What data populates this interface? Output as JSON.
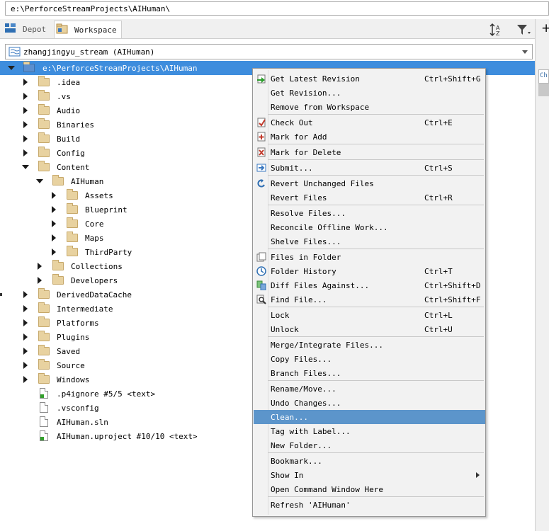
{
  "path_bar": {
    "value": "e:\\PerforceStreamProjects\\AIHuman\\"
  },
  "tabs": [
    {
      "label": "Depot",
      "icon": "depot-icon"
    },
    {
      "label": "Workspace",
      "icon": "workspace-icon"
    }
  ],
  "toolbar": {
    "sort_icon": "sort-az-icon",
    "filter_icon": "filter-icon"
  },
  "right_panel": {
    "plus_label": "+",
    "header_fragment": "Ch"
  },
  "workspace": {
    "name": "zhangjingyu_stream (AIHuman)"
  },
  "tree": {
    "root": "e:\\PerforceStreamProjects\\AIHuman",
    "items": [
      {
        "label": ".idea",
        "type": "folder",
        "depth": 1,
        "state": "collapsed"
      },
      {
        "label": ".vs",
        "type": "folder",
        "depth": 1,
        "state": "collapsed"
      },
      {
        "label": "Audio",
        "type": "folder",
        "depth": 1,
        "state": "collapsed"
      },
      {
        "label": "Binaries",
        "type": "folder",
        "depth": 1,
        "state": "collapsed"
      },
      {
        "label": "Build",
        "type": "folder",
        "depth": 1,
        "state": "collapsed"
      },
      {
        "label": "Config",
        "type": "folder",
        "depth": 1,
        "state": "collapsed"
      },
      {
        "label": "Content",
        "type": "folder",
        "depth": 1,
        "state": "expanded"
      },
      {
        "label": "AIHuman",
        "type": "folder",
        "depth": 2,
        "state": "expanded"
      },
      {
        "label": "Assets",
        "type": "folder",
        "depth": 3,
        "state": "collapsed"
      },
      {
        "label": "Blueprint",
        "type": "folder",
        "depth": 3,
        "state": "collapsed"
      },
      {
        "label": "Core",
        "type": "folder",
        "depth": 3,
        "state": "collapsed"
      },
      {
        "label": "Maps",
        "type": "folder",
        "depth": 3,
        "state": "collapsed"
      },
      {
        "label": "ThirdParty",
        "type": "folder",
        "depth": 3,
        "state": "collapsed"
      },
      {
        "label": "Collections",
        "type": "folder",
        "depth": 2,
        "state": "collapsed"
      },
      {
        "label": "Developers",
        "type": "folder",
        "depth": 2,
        "state": "collapsed"
      },
      {
        "label": "DerivedDataCache",
        "type": "folder",
        "depth": 1,
        "state": "collapsed"
      },
      {
        "label": "Intermediate",
        "type": "folder",
        "depth": 1,
        "state": "collapsed"
      },
      {
        "label": "Platforms",
        "type": "folder",
        "depth": 1,
        "state": "collapsed"
      },
      {
        "label": "Plugins",
        "type": "folder",
        "depth": 1,
        "state": "collapsed"
      },
      {
        "label": "Saved",
        "type": "folder",
        "depth": 1,
        "state": "collapsed"
      },
      {
        "label": "Source",
        "type": "folder",
        "depth": 1,
        "state": "collapsed"
      },
      {
        "label": "Windows",
        "type": "folder",
        "depth": 1,
        "state": "collapsed"
      },
      {
        "label": ".p4ignore #5/5 <text>",
        "type": "file",
        "depth": 1,
        "versioned": true
      },
      {
        "label": ".vsconfig",
        "type": "file",
        "depth": 1,
        "versioned": false
      },
      {
        "label": "AIHuman.sln",
        "type": "file",
        "depth": 1,
        "versioned": false
      },
      {
        "label": "AIHuman.uproject #10/10 <text>",
        "type": "file",
        "depth": 1,
        "versioned": true
      }
    ]
  },
  "context_menu": {
    "highlighted": "Clean...",
    "groups": [
      [
        {
          "label": "Get Latest Revision",
          "shortcut": "Ctrl+Shift+G",
          "icon": "get-latest-icon"
        },
        {
          "label": "Get Revision...",
          "shortcut": ""
        },
        {
          "label": "Remove from Workspace",
          "shortcut": ""
        }
      ],
      [
        {
          "label": "Check Out",
          "shortcut": "Ctrl+E",
          "icon": "check-out-icon"
        },
        {
          "label": "Mark for Add",
          "shortcut": "",
          "icon": "mark-for-add-icon"
        }
      ],
      [
        {
          "label": "Mark for Delete",
          "shortcut": "",
          "icon": "mark-for-delete-icon"
        }
      ],
      [
        {
          "label": "Submit...",
          "shortcut": "Ctrl+S",
          "icon": "submit-icon"
        }
      ],
      [
        {
          "label": "Revert Unchanged Files",
          "shortcut": "",
          "icon": "revert-icon"
        },
        {
          "label": "Revert Files",
          "shortcut": "Ctrl+R"
        }
      ],
      [
        {
          "label": "Resolve Files...",
          "shortcut": ""
        },
        {
          "label": "Reconcile Offline Work...",
          "shortcut": ""
        },
        {
          "label": "Shelve Files...",
          "shortcut": ""
        }
      ],
      [
        {
          "label": "Files in Folder",
          "shortcut": "",
          "icon": "files-in-folder-icon"
        },
        {
          "label": "Folder History",
          "shortcut": "Ctrl+T",
          "icon": "history-icon"
        },
        {
          "label": "Diff Files Against...",
          "shortcut": "Ctrl+Shift+D",
          "icon": "diff-icon"
        },
        {
          "label": "Find File...",
          "shortcut": "Ctrl+Shift+F",
          "icon": "find-file-icon"
        }
      ],
      [
        {
          "label": "Lock",
          "shortcut": "Ctrl+L"
        },
        {
          "label": "Unlock",
          "shortcut": "Ctrl+U"
        }
      ],
      [
        {
          "label": "Merge/Integrate Files...",
          "shortcut": ""
        },
        {
          "label": "Copy Files...",
          "shortcut": ""
        },
        {
          "label": "Branch Files...",
          "shortcut": ""
        }
      ],
      [
        {
          "label": "Rename/Move...",
          "shortcut": ""
        },
        {
          "label": "Undo Changes...",
          "shortcut": ""
        },
        {
          "label": "Clean...",
          "shortcut": ""
        },
        {
          "label": "Tag with Label...",
          "shortcut": ""
        },
        {
          "label": "New Folder...",
          "shortcut": ""
        }
      ],
      [
        {
          "label": "Bookmark...",
          "shortcut": ""
        },
        {
          "label": "Show In",
          "shortcut": "",
          "submenu": true
        },
        {
          "label": "Open Command Window Here",
          "shortcut": ""
        }
      ],
      [
        {
          "label": "Refresh 'AIHuman'",
          "shortcut": ""
        }
      ]
    ]
  }
}
